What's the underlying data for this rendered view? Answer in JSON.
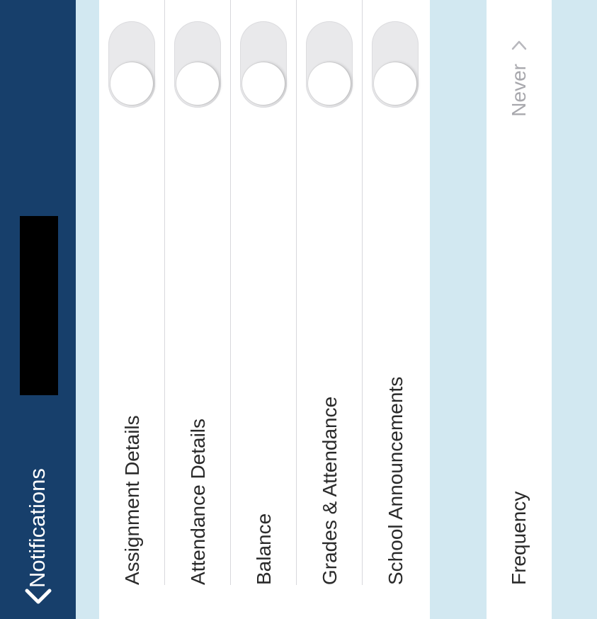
{
  "navbar": {
    "back_label": "Notifications"
  },
  "notifications": {
    "items": [
      {
        "label": "Assignment Details",
        "enabled": false
      },
      {
        "label": "Attendance Details",
        "enabled": false
      },
      {
        "label": "Balance",
        "enabled": false
      },
      {
        "label": "Grades & Attendance",
        "enabled": false
      },
      {
        "label": "School Announcements",
        "enabled": false
      }
    ]
  },
  "frequency": {
    "label": "Frequency",
    "value": "Never"
  },
  "colors": {
    "navbar": "#173f6b",
    "background": "#d2e8f1",
    "toggle_off": "#e9e9eb"
  },
  "icons": {
    "back": "chevron-left-icon",
    "disclosure": "chevron-right-icon"
  }
}
